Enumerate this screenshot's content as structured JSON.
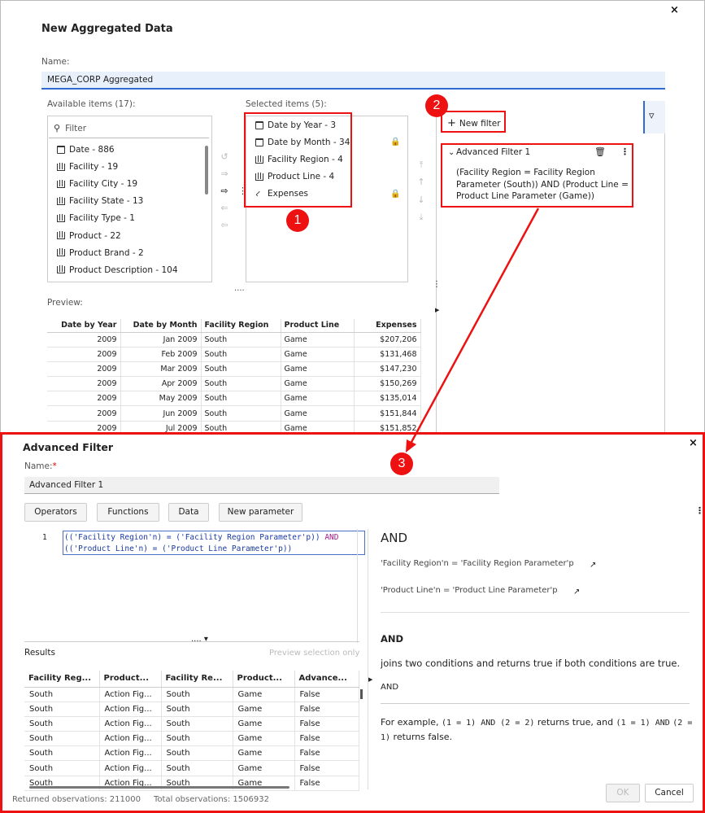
{
  "dialog1": {
    "title": "New Aggregated Data",
    "close_glyph": "×",
    "name_label": "Name:",
    "name_value": "MEGA_CORP Aggregated",
    "available_label": "Available items (17):",
    "filter_placeholder": "Filter",
    "available_items": [
      {
        "label": "Date - 886",
        "icon": "calendar-icon"
      },
      {
        "label": "Facility - 19",
        "icon": "category-icon"
      },
      {
        "label": "Facility City - 19",
        "icon": "category-icon"
      },
      {
        "label": "Facility State - 13",
        "icon": "category-icon"
      },
      {
        "label": "Facility Type - 1",
        "icon": "category-icon"
      },
      {
        "label": "Product - 22",
        "icon": "category-icon"
      },
      {
        "label": "Product Brand - 2",
        "icon": "category-icon"
      },
      {
        "label": "Product Description - 104",
        "icon": "category-icon"
      }
    ],
    "selected_label": "Selected items (5):",
    "selected_items": [
      {
        "label": "Date by Year - 3",
        "icon": "calendar-icon"
      },
      {
        "label": "Date by Month - 34",
        "icon": "calendar-icon"
      },
      {
        "label": "Facility Region - 4",
        "icon": "category-icon"
      },
      {
        "label": "Product Line - 4",
        "icon": "category-icon"
      },
      {
        "label": "Expenses",
        "icon": "measure-icon"
      }
    ],
    "new_filter_label": "New filter",
    "filter_title": "Advanced Filter 1",
    "filter_expression": "(Facility Region = Facility Region Parameter (South)) AND (Product Line = Product Line Parameter (Game))",
    "preview_label": "Preview:",
    "preview_columns": [
      "Date by Year",
      "Date by Month",
      "Facility Region",
      "Product Line",
      "Expenses"
    ],
    "preview_rows": [
      [
        "2009",
        "Jan 2009",
        "South",
        "Game",
        "$207,206"
      ],
      [
        "2009",
        "Feb 2009",
        "South",
        "Game",
        "$131,468"
      ],
      [
        "2009",
        "Mar 2009",
        "South",
        "Game",
        "$147,230"
      ],
      [
        "2009",
        "Apr 2009",
        "South",
        "Game",
        "$150,269"
      ],
      [
        "2009",
        "May 2009",
        "South",
        "Game",
        "$135,014"
      ],
      [
        "2009",
        "Jun 2009",
        "South",
        "Game",
        "$151,844"
      ],
      [
        "2009",
        "Jul 2009",
        "South",
        "Game",
        "$151,852"
      ]
    ]
  },
  "badges": [
    "1",
    "2",
    "3"
  ],
  "dialog2": {
    "title": "Advanced Filter",
    "close_glyph": "×",
    "name_label": "Name:",
    "required_mark": "*",
    "name_value": "Advanced Filter 1",
    "buttons": [
      "Operators",
      "Functions",
      "Data",
      "New parameter"
    ],
    "line_number": "1",
    "code_line1_a": "(('Facility Region'n) = ('Facility Region Parameter'p))",
    "code_line1_kw": "AND",
    "code_line2": "(('Product Line'n) = ('Product Line Parameter'p))",
    "results_label": "Results",
    "preview_only": "Preview selection only",
    "results_columns": [
      "Facility Reg...",
      "Product...",
      "Facility Re...",
      "Product...",
      "Advance..."
    ],
    "results_rows": [
      [
        "South",
        "Action Fig...",
        "South",
        "Game",
        "False"
      ],
      [
        "South",
        "Action Fig...",
        "South",
        "Game",
        "False"
      ],
      [
        "South",
        "Action Fig...",
        "South",
        "Game",
        "False"
      ],
      [
        "South",
        "Action Fig...",
        "South",
        "Game",
        "False"
      ],
      [
        "South",
        "Action Fig...",
        "South",
        "Game",
        "False"
      ],
      [
        "South",
        "Action Fig...",
        "South",
        "Game",
        "False"
      ],
      [
        "South",
        "Action Fig...",
        "South",
        "Game",
        "False"
      ]
    ],
    "help_heading": "AND",
    "help_ex1": "'Facility Region'n = 'Facility Region Parameter'p",
    "help_ex2": "'Product Line'n = 'Product Line Parameter'p",
    "help_sub": "AND",
    "help_desc": "joins two conditions and returns true if both conditions are true.",
    "help_syntax": "AND",
    "help_example_prefix": "For example,",
    "help_example_code1": "(1 = 1) AND (2 = 2)",
    "help_example_mid": "returns true, and",
    "help_example_code2": "(1 = 1) AND",
    "help_example_code3": "(2 = 1)",
    "help_example_suffix": "returns false.",
    "ok_label": "OK",
    "cancel_label": "Cancel",
    "returned_obs": "Returned observations: 211000",
    "total_obs": "Total observations: 1506932"
  },
  "colors": {
    "accent_red": "#ee1111",
    "focus_blue": "#2f6bd0",
    "keyword_purple": "#a0208a"
  }
}
